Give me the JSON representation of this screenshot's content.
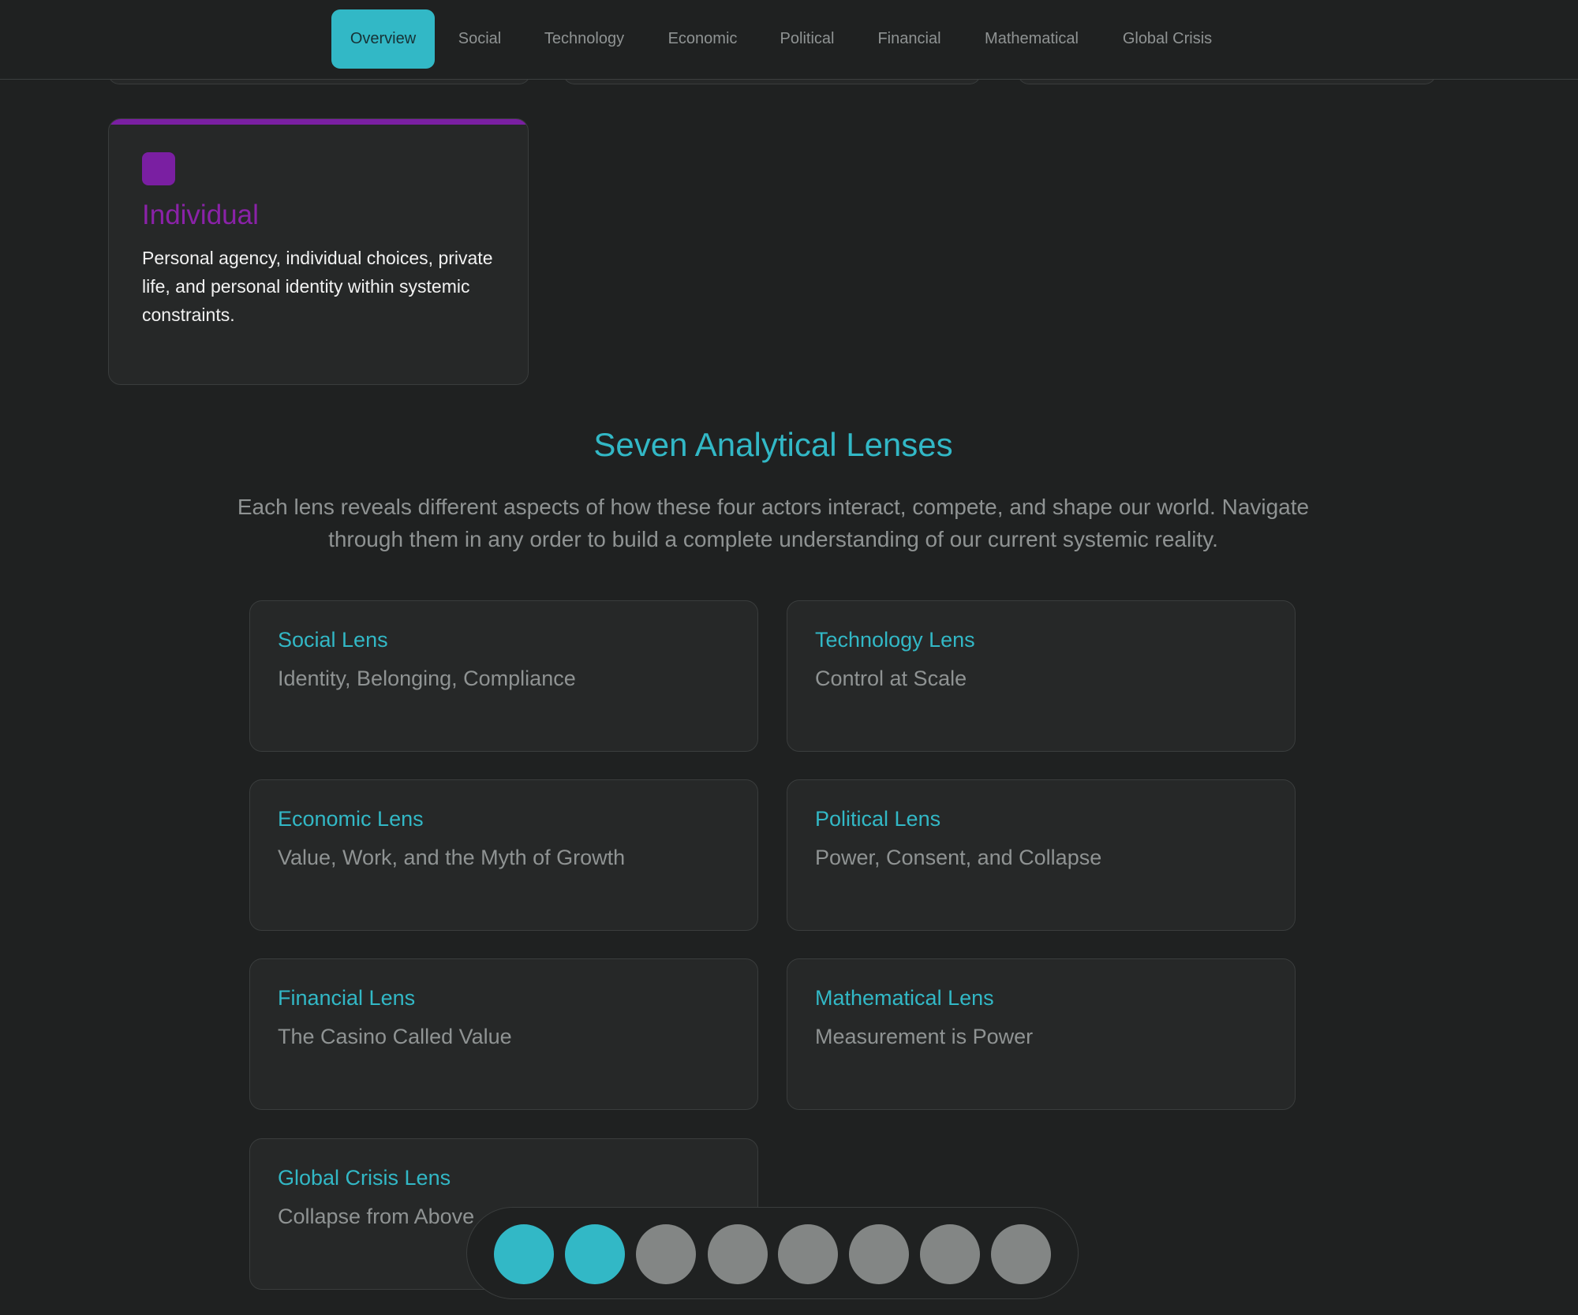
{
  "nav": {
    "tabs": [
      {
        "label": "Overview",
        "active": true
      },
      {
        "label": "Social"
      },
      {
        "label": "Technology"
      },
      {
        "label": "Economic"
      },
      {
        "label": "Political"
      },
      {
        "label": "Financial"
      },
      {
        "label": "Mathematical"
      },
      {
        "label": "Global Crisis"
      }
    ]
  },
  "actor": {
    "title": "Individual",
    "description": "Personal agency, individual choices, private life, and personal identity within systemic constraints.",
    "color": "#7a1fa2"
  },
  "section": {
    "title": "Seven Analytical Lenses",
    "subtitle": "Each lens reveals different aspects of how these four actors interact, compete, and shape our world. Navigate through them in any order to build a complete understanding of our current systemic reality."
  },
  "lenses": [
    {
      "title": "Social Lens",
      "subtitle": "Identity, Belonging, Compliance"
    },
    {
      "title": "Technology Lens",
      "subtitle": "Control at Scale"
    },
    {
      "title": "Economic Lens",
      "subtitle": "Value, Work, and the Myth of Growth"
    },
    {
      "title": "Political Lens",
      "subtitle": "Power, Consent, and Collapse"
    },
    {
      "title": "Financial Lens",
      "subtitle": "The Casino Called Value"
    },
    {
      "title": "Mathematical Lens",
      "subtitle": "Measurement is Power"
    },
    {
      "title": "Global Crisis Lens",
      "subtitle": "Collapse from Above"
    }
  ],
  "pager": {
    "total": 8,
    "active": [
      0,
      1
    ]
  },
  "colors": {
    "accent": "#32b8c6",
    "background": "#1f2121",
    "card": "#262828",
    "muted": "#8f9393",
    "inactive_dot": "#838685"
  }
}
